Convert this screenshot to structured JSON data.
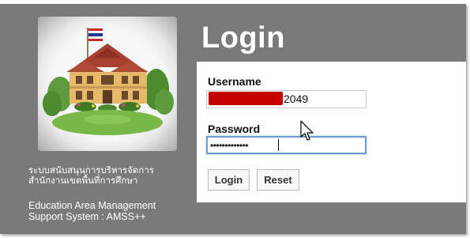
{
  "branding": {
    "thai_line1": "ระบบสนับสนุนการบริหารจัดการ",
    "thai_line2": "สำนักงานเขตพื้นที่การศึกษา",
    "en_line1": "Education Area Management",
    "en_line2": "Support System : AMSS++"
  },
  "login": {
    "title": "Login",
    "username_label": "Username",
    "username_visible_suffix": "2049",
    "password_label": "Password",
    "password_masked": "•••••••••••••",
    "login_button": "Login",
    "reset_button": "Reset"
  },
  "icons": {
    "logo": "school-building-logo-image",
    "pointer": "mouse-cursor-icon"
  },
  "colors": {
    "panel_bg": "#7a7a7a",
    "card_bg": "#ffffff",
    "redaction": "#c40000",
    "focus_border": "#6a9bd6"
  }
}
